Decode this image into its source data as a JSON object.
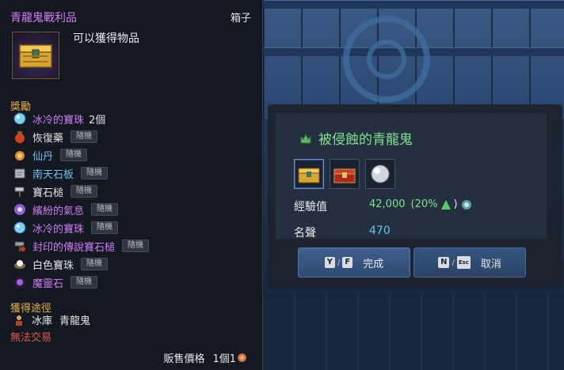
{
  "colors": {
    "item_name": "#d47cf5",
    "section_header": "#e9b24a",
    "untradeable": "#e05a4a",
    "dialog_title": "#7ee28c",
    "fame_value": "#6fc1f0"
  },
  "tooltip": {
    "title": "青龍鬼戰利品",
    "type": "箱子",
    "icon": "treasure-chest-icon",
    "description": "可以獲得物品",
    "rewards_header": "獎勵",
    "rewards": [
      {
        "name": "冰冷的寶珠",
        "qty": "2個",
        "tag": "",
        "icon": "ice-orb-icon"
      },
      {
        "name": "恢復藥",
        "qty": "",
        "tag": "隨機",
        "icon": "potion-icon"
      },
      {
        "name": "仙丹",
        "qty": "",
        "tag": "隨機",
        "icon": "elixir-icon"
      },
      {
        "name": "南天石板",
        "qty": "",
        "tag": "隨機",
        "icon": "stone-tablet-icon"
      },
      {
        "name": "寶石槌",
        "qty": "",
        "tag": "隨機",
        "icon": "hammer-icon"
      },
      {
        "name": "繽紛的氣息",
        "qty": "",
        "tag": "隨機",
        "icon": "aura-icon"
      },
      {
        "name": "冰冷的寶珠",
        "qty": "",
        "tag": "隨機",
        "icon": "ice-orb-icon"
      },
      {
        "name": "封印的傳說寶石槌",
        "qty": "",
        "tag": "隨機",
        "icon": "sealed-hammer-icon"
      },
      {
        "name": "白色寶珠",
        "qty": "",
        "tag": "隨機",
        "icon": "white-orb-icon"
      },
      {
        "name": "魔靈石",
        "qty": "",
        "tag": "隨機",
        "icon": "soul-stone-icon"
      }
    ],
    "obtain_header": "獲得途徑",
    "obtain_location": "冰庫",
    "obtain_source": "青龍鬼",
    "untradeable": "無法交易",
    "price_label": "販售價格",
    "price_value": "1個1",
    "price_icon": "copper-coin-icon"
  },
  "dialog": {
    "title": "被侵蝕的青龍鬼",
    "title_icon": "boss-icon",
    "reward_icons": [
      "treasure-chest-icon",
      "red-chest-icon",
      "silver-orb-icon"
    ],
    "exp_label": "經驗值",
    "exp_value": "42,000",
    "exp_bonus_open": "(",
    "exp_bonus_pct": "20%",
    "exp_bonus_close": ")",
    "fame_label": "名聲",
    "fame_value": "470",
    "confirm": {
      "key1": "Y",
      "key2": "F",
      "label": "完成"
    },
    "cancel": {
      "key1": "N",
      "key2": "Esc",
      "label": "取消"
    }
  }
}
